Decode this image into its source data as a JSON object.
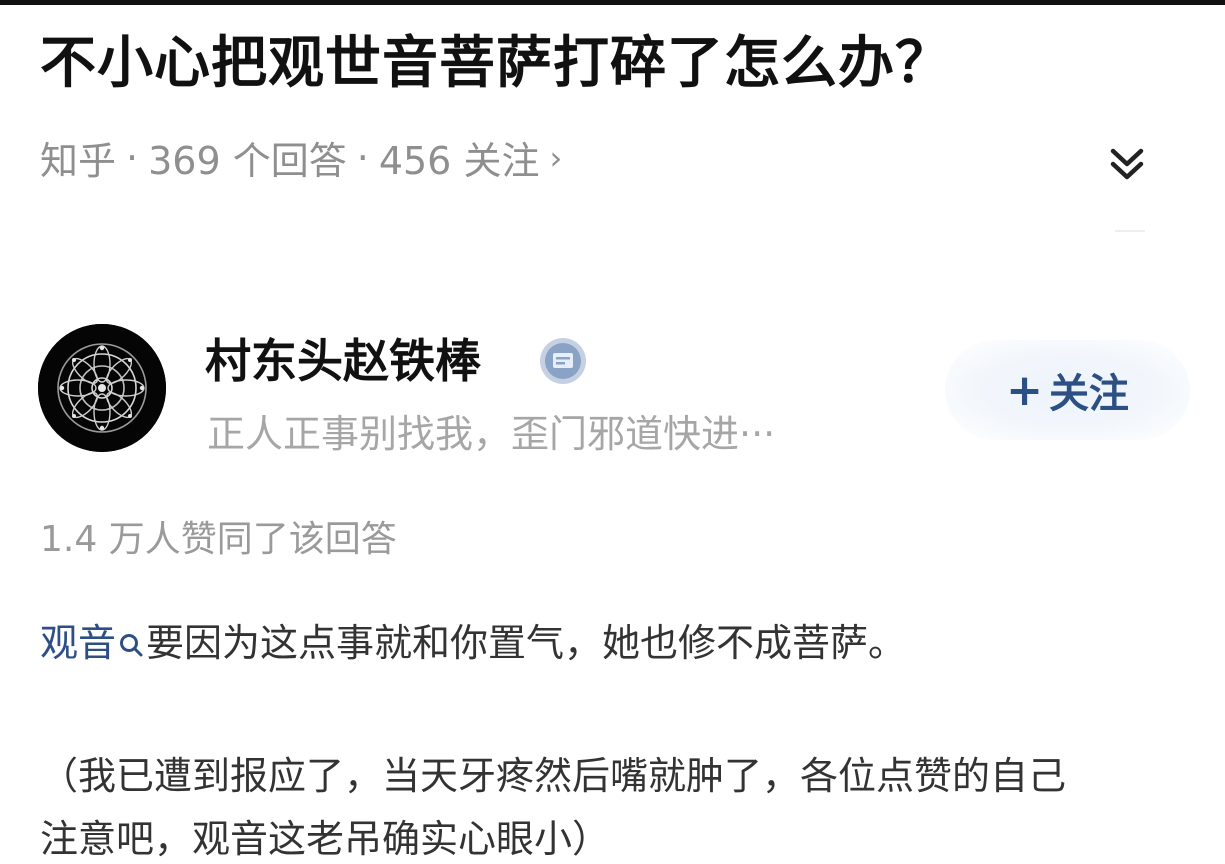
{
  "question": {
    "title": "不小心把观世音菩萨打碎了怎么办？",
    "source": "知乎",
    "separator": "·",
    "answers_count": "369 个回答",
    "followers_count": "456 关注",
    "more_arrow": "›"
  },
  "icons": {
    "expand": "chevron-double-down-icon",
    "verified": "verified-badge-icon",
    "search": "search-icon"
  },
  "author": {
    "name": "村东头赵铁棒",
    "bio": "正人正事别找我，歪门邪道快进···",
    "follow_plus": "+",
    "follow_label": "关注"
  },
  "answer": {
    "upvote_text": "1.4 万人赞同了该回答",
    "link_word": "观音",
    "line1_rest": "要因为这点事就和你置气，她也修不成菩萨。",
    "line2": "（我已遭到报应了，当天牙疼然后嘴就肿了，各位点赞的自己",
    "line3": "注意吧，观音这老吊确实心眼小）"
  },
  "colors": {
    "title": "#111111",
    "meta": "#8f8f8f",
    "bio": "#a6a6a6",
    "follow_text": "#2c4f84",
    "follow_bg": "#edf3fb",
    "link": "#2d4f86",
    "verified": "#7f98be"
  }
}
